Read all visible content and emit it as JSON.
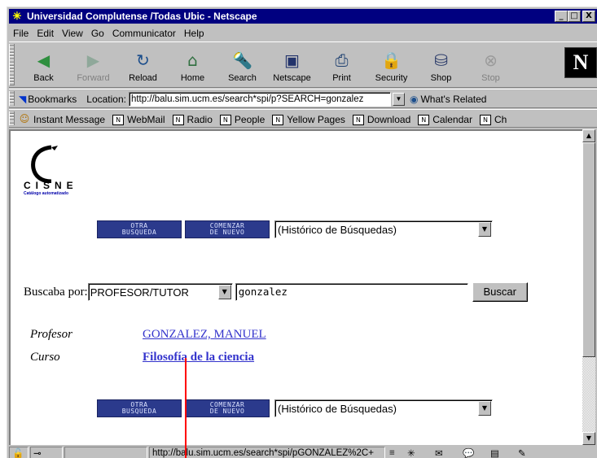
{
  "window": {
    "title": "Universidad Complutense /Todas Ubic - Netscape",
    "minimize": "_",
    "maximize": "□",
    "close": "X"
  },
  "menu": [
    "File",
    "Edit",
    "View",
    "Go",
    "Communicator",
    "Help"
  ],
  "nav_toolbar": [
    {
      "label": "Back",
      "icon": "back-arrow-icon",
      "glyph": "◀",
      "color": "#2f8f3f",
      "enabled": true
    },
    {
      "label": "Forward",
      "icon": "forward-arrow-icon",
      "glyph": "▶",
      "color": "#8fa89a",
      "enabled": false
    },
    {
      "label": "Reload",
      "icon": "reload-icon",
      "glyph": "↻",
      "color": "#1d4f8c",
      "enabled": true
    },
    {
      "label": "Home",
      "icon": "home-icon",
      "glyph": "⌂",
      "color": "#2f6f3f",
      "enabled": true
    },
    {
      "label": "Search",
      "icon": "search-icon",
      "glyph": "🔦",
      "color": "#8a6d00",
      "enabled": true
    },
    {
      "label": "Netscape",
      "icon": "netscape-icon",
      "glyph": "▣",
      "color": "#22336b",
      "enabled": true
    },
    {
      "label": "Print",
      "icon": "print-icon",
      "glyph": "⎙",
      "color": "#1d3f6f",
      "enabled": true
    },
    {
      "label": "Security",
      "icon": "security-lock-icon",
      "glyph": "🔒",
      "color": "#6b4a00",
      "enabled": true
    },
    {
      "label": "Shop",
      "icon": "shop-icon",
      "glyph": "⛁",
      "color": "#2d3d6b",
      "enabled": true
    },
    {
      "label": "Stop",
      "icon": "stop-icon",
      "glyph": "⊗",
      "color": "#9a9a9a",
      "enabled": false
    }
  ],
  "location_bar": {
    "bookmarks": "Bookmarks",
    "location_label": "Location:",
    "url": "http://balu.sim.ucm.es/search*spi/p?SEARCH=gonzalez",
    "related": "What's Related"
  },
  "personal_toolbar": [
    "Instant Message",
    "WebMail",
    "Radio",
    "People",
    "Yellow Pages",
    "Download",
    "Calendar",
    "Ch"
  ],
  "page": {
    "logo_name": "CISNE",
    "logo_sub": "Catálogo automatizado",
    "btn_otra": [
      "OTRA",
      "BUSQUEDA"
    ],
    "btn_comenzar": [
      "COMENZAR",
      "DE NUEVO"
    ],
    "history_select": "(Histórico de Búsquedas)",
    "search_label": "Buscaba por:",
    "search_type": "PROFESOR/TUTOR",
    "search_query": "gonzalez",
    "search_button": "Buscar",
    "results": [
      {
        "label": "Profesor",
        "value": "GONZALEZ, MANUEL",
        "bold": false
      },
      {
        "label": "Curso",
        "value": "Filosofía de la ciencia",
        "bold": true
      }
    ]
  },
  "status": {
    "url": "http://balu.sim.ucm.es/search*spi/pGONZALEZ%2C+"
  }
}
